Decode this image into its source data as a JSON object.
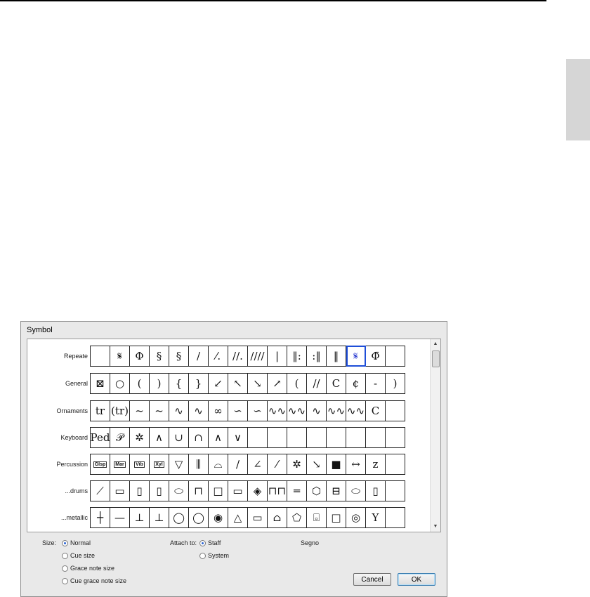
{
  "dialog": {
    "title": "Symbol",
    "rows": [
      {
        "label": "Repeate",
        "cells": [
          "",
          "𝄋",
          "Φ",
          "§",
          "§",
          "/",
          "⁄.",
          "//.",
          "////",
          "|",
          "‖:",
          ":‖",
          "‖",
          "𝄋",
          "Φ̄",
          ""
        ]
      },
      {
        "label": "General",
        "cells": [
          "⊠",
          "○",
          "(",
          ")",
          "{",
          "}",
          "↙",
          "↖",
          "↘",
          "↗",
          "(",
          "//",
          "C",
          "¢",
          "-",
          ")"
        ]
      },
      {
        "label": "Ornaments",
        "cells": [
          "tr",
          "(tr)",
          "~",
          "~",
          "∿",
          "∿",
          "∞",
          "∽",
          "∽",
          "∿∿",
          "∿∿",
          "∿",
          "∿∿",
          "∿∿",
          "C",
          ""
        ]
      },
      {
        "label": "Keyboard",
        "cells": [
          "Ped",
          "𝒫",
          "✲",
          "∧",
          "∪",
          "∩",
          "∧",
          "∨",
          "",
          "",
          "",
          "",
          "",
          "",
          "",
          ""
        ]
      },
      {
        "label": "Percussion",
        "cells": [
          "Glsp",
          "Mar",
          "Vib",
          "Xyl",
          "▽",
          "⫼",
          "⌓",
          "∕",
          "∠",
          "⁄",
          "✲",
          "↘",
          "■",
          "↔",
          "z",
          ""
        ]
      },
      {
        "label": "...drums",
        "cells": [
          "⟋",
          "▭",
          "▯",
          "▯",
          "⬭",
          "⊓",
          "□",
          "▭",
          "◈",
          "⊓⊓",
          "═",
          "⬡",
          "⊟",
          "⬭",
          "▯",
          ""
        ]
      },
      {
        "label": "...metallic",
        "cells": [
          "┼",
          "—",
          "⊥",
          "⊥",
          "◯",
          "◯",
          "◉",
          "△",
          "▭",
          "⌂",
          "⬠",
          "⌻",
          "□",
          "◎",
          "Y",
          ""
        ]
      }
    ],
    "size_label": "Size:",
    "size_options": [
      "Normal",
      "Cue size",
      "Grace note size",
      "Cue grace note size"
    ],
    "attach_label": "Attach to:",
    "attach_options": [
      "Staff",
      "System"
    ],
    "selected_name": "Segno",
    "cancel_label": "Cancel",
    "ok_label": "OK"
  },
  "colors": {
    "selection": "#1e4ed8",
    "dialog_bg": "#e9e9e9"
  }
}
